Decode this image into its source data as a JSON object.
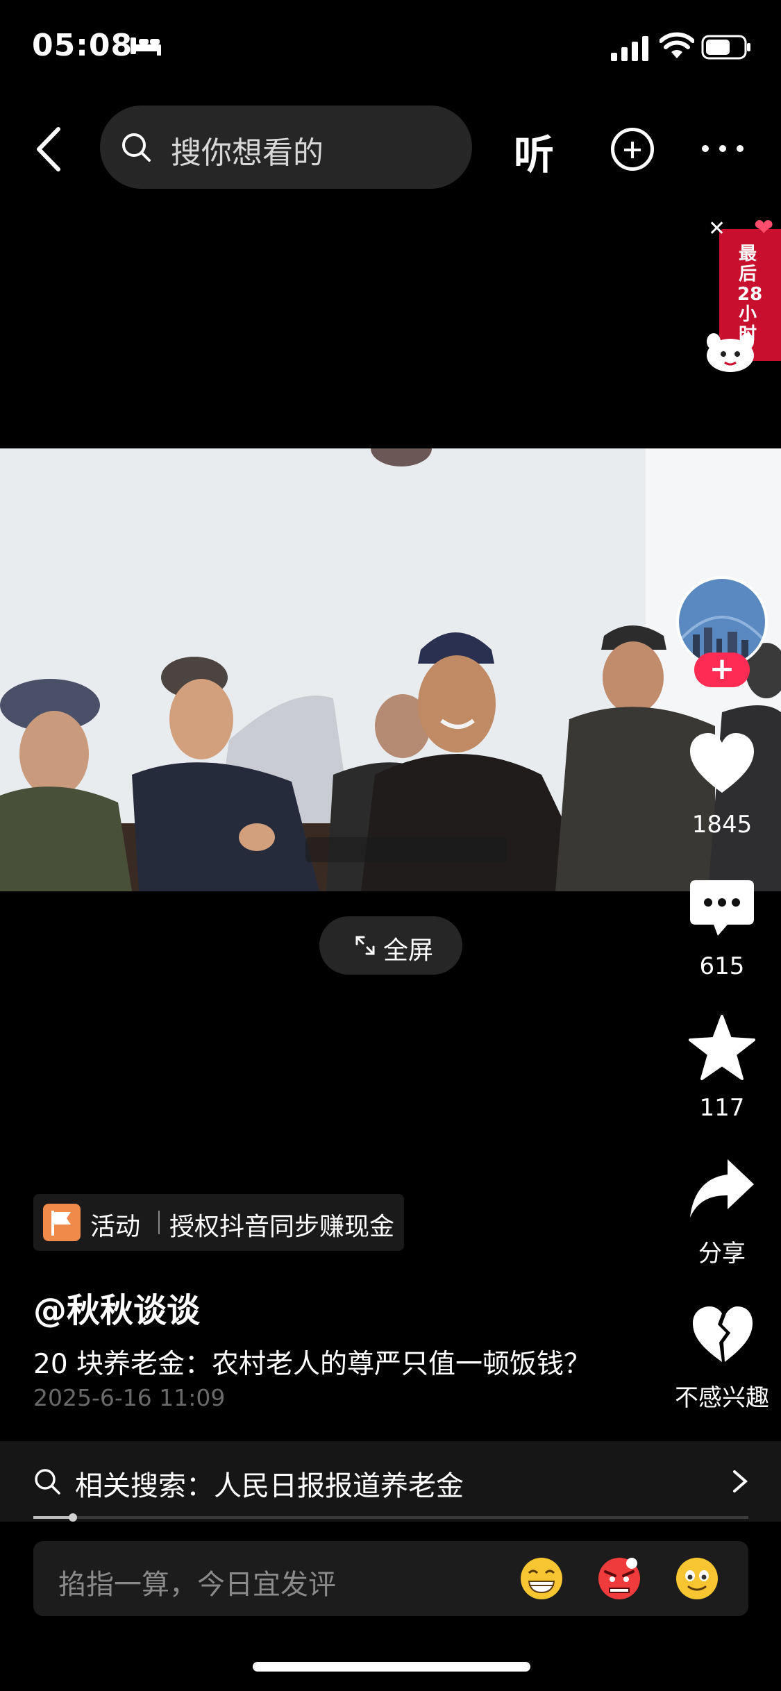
{
  "status": {
    "time": "05:08"
  },
  "top_bar": {
    "search_placeholder": "搜你想看的",
    "listen_label": "听"
  },
  "promo": {
    "text": "最后28小时"
  },
  "video": {
    "fullscreen_label": "全屏"
  },
  "stats": {
    "likes": "1845",
    "comments": "615",
    "favorites": "117",
    "share_label": "分享",
    "not_interested_label": "不感兴趣"
  },
  "activity": {
    "tag": "活动",
    "text": "授权抖音同步赚现金"
  },
  "post": {
    "author": "@秋秋谈谈",
    "description": "20 块养老金：农村老人的尊严只值一顿饭钱？",
    "date": "2025-6-16 11:09"
  },
  "related": {
    "text": "相关搜索：人民日报报道养老金"
  },
  "playback": {
    "progress_fraction": 0.055
  },
  "comment_bar": {
    "placeholder": "掐指一算，今日宜发评"
  },
  "colors": {
    "accent": "#fe2c55",
    "promo_red": "#c8102e",
    "activity_flag": "#f08a4b"
  }
}
